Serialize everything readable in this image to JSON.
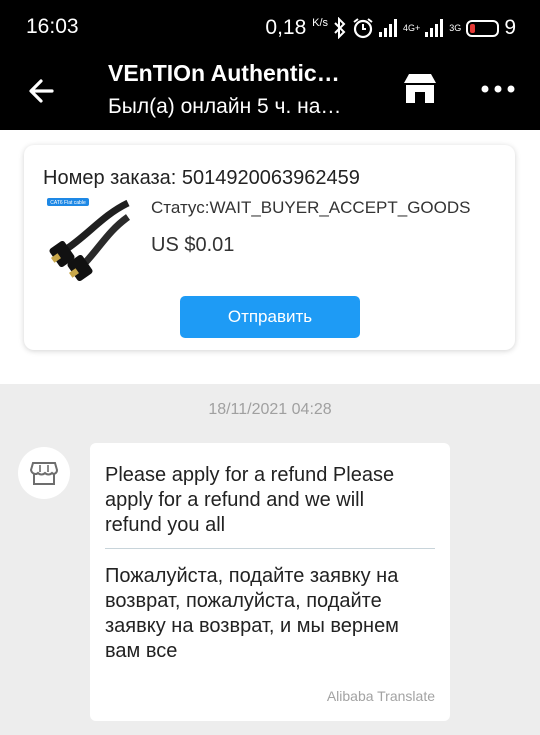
{
  "status_bar": {
    "time": "16:03",
    "speed": "0,18",
    "speed_unit": "K/s",
    "network_1": "4G+",
    "network_2": "3G",
    "battery": "9"
  },
  "header": {
    "title": "VEnTIOn Authentic…",
    "subtitle": "Был(а) онлайн 5 ч. на…"
  },
  "order": {
    "number": "Номер заказа: 5014920063962459",
    "status": "Статус:WAIT_BUYER_ACCEPT_GOODS",
    "price": "US $0.01",
    "send_label": "Отправить",
    "image_label": "CAT6 Flat cable"
  },
  "chat": {
    "timestamp": "18/11/2021 04:28",
    "message": "Please apply for a refund Please apply for a refund and we will refund you all",
    "translation": "Пожалуйста, подайте заявку на возврат, пожалуйста, подайте заявку на возврат, и мы вернем вам все",
    "translation_credit": "Alibaba Translate"
  },
  "colors": {
    "accent": "#1e9bf5",
    "bar_bg": "#000000",
    "chat_bg": "#ededed",
    "battery_low": "#e53935"
  }
}
